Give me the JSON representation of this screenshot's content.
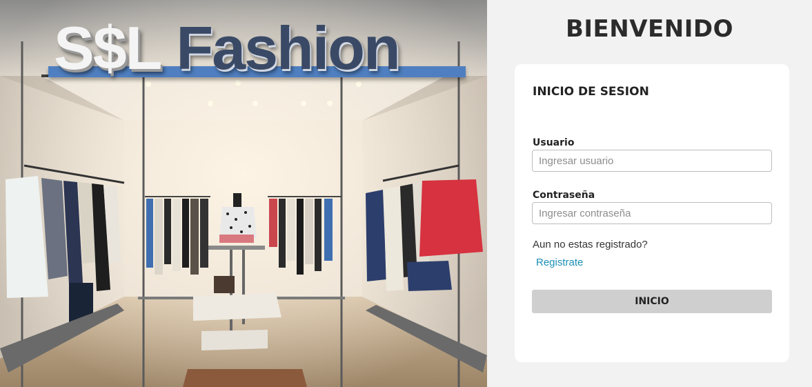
{
  "store": {
    "sign_brand": "S$L",
    "sign_word": "Fashion"
  },
  "login": {
    "welcome": "BIENVENIDO",
    "title": "INICIO DE SESION",
    "user_label": "Usuario",
    "user_placeholder": "Ingresar usuario",
    "password_label": "Contraseña",
    "password_placeholder": "Ingresar contraseña",
    "question": "Aun no estas registrado?",
    "register_link": "Registrate",
    "submit": "INICIO"
  },
  "colors": {
    "page_bg": "#f2f2f2",
    "card_bg": "#ffffff",
    "link": "#1a8fb5",
    "button_bg": "#cfcfcf",
    "sign_band": "#4f7fc0"
  }
}
